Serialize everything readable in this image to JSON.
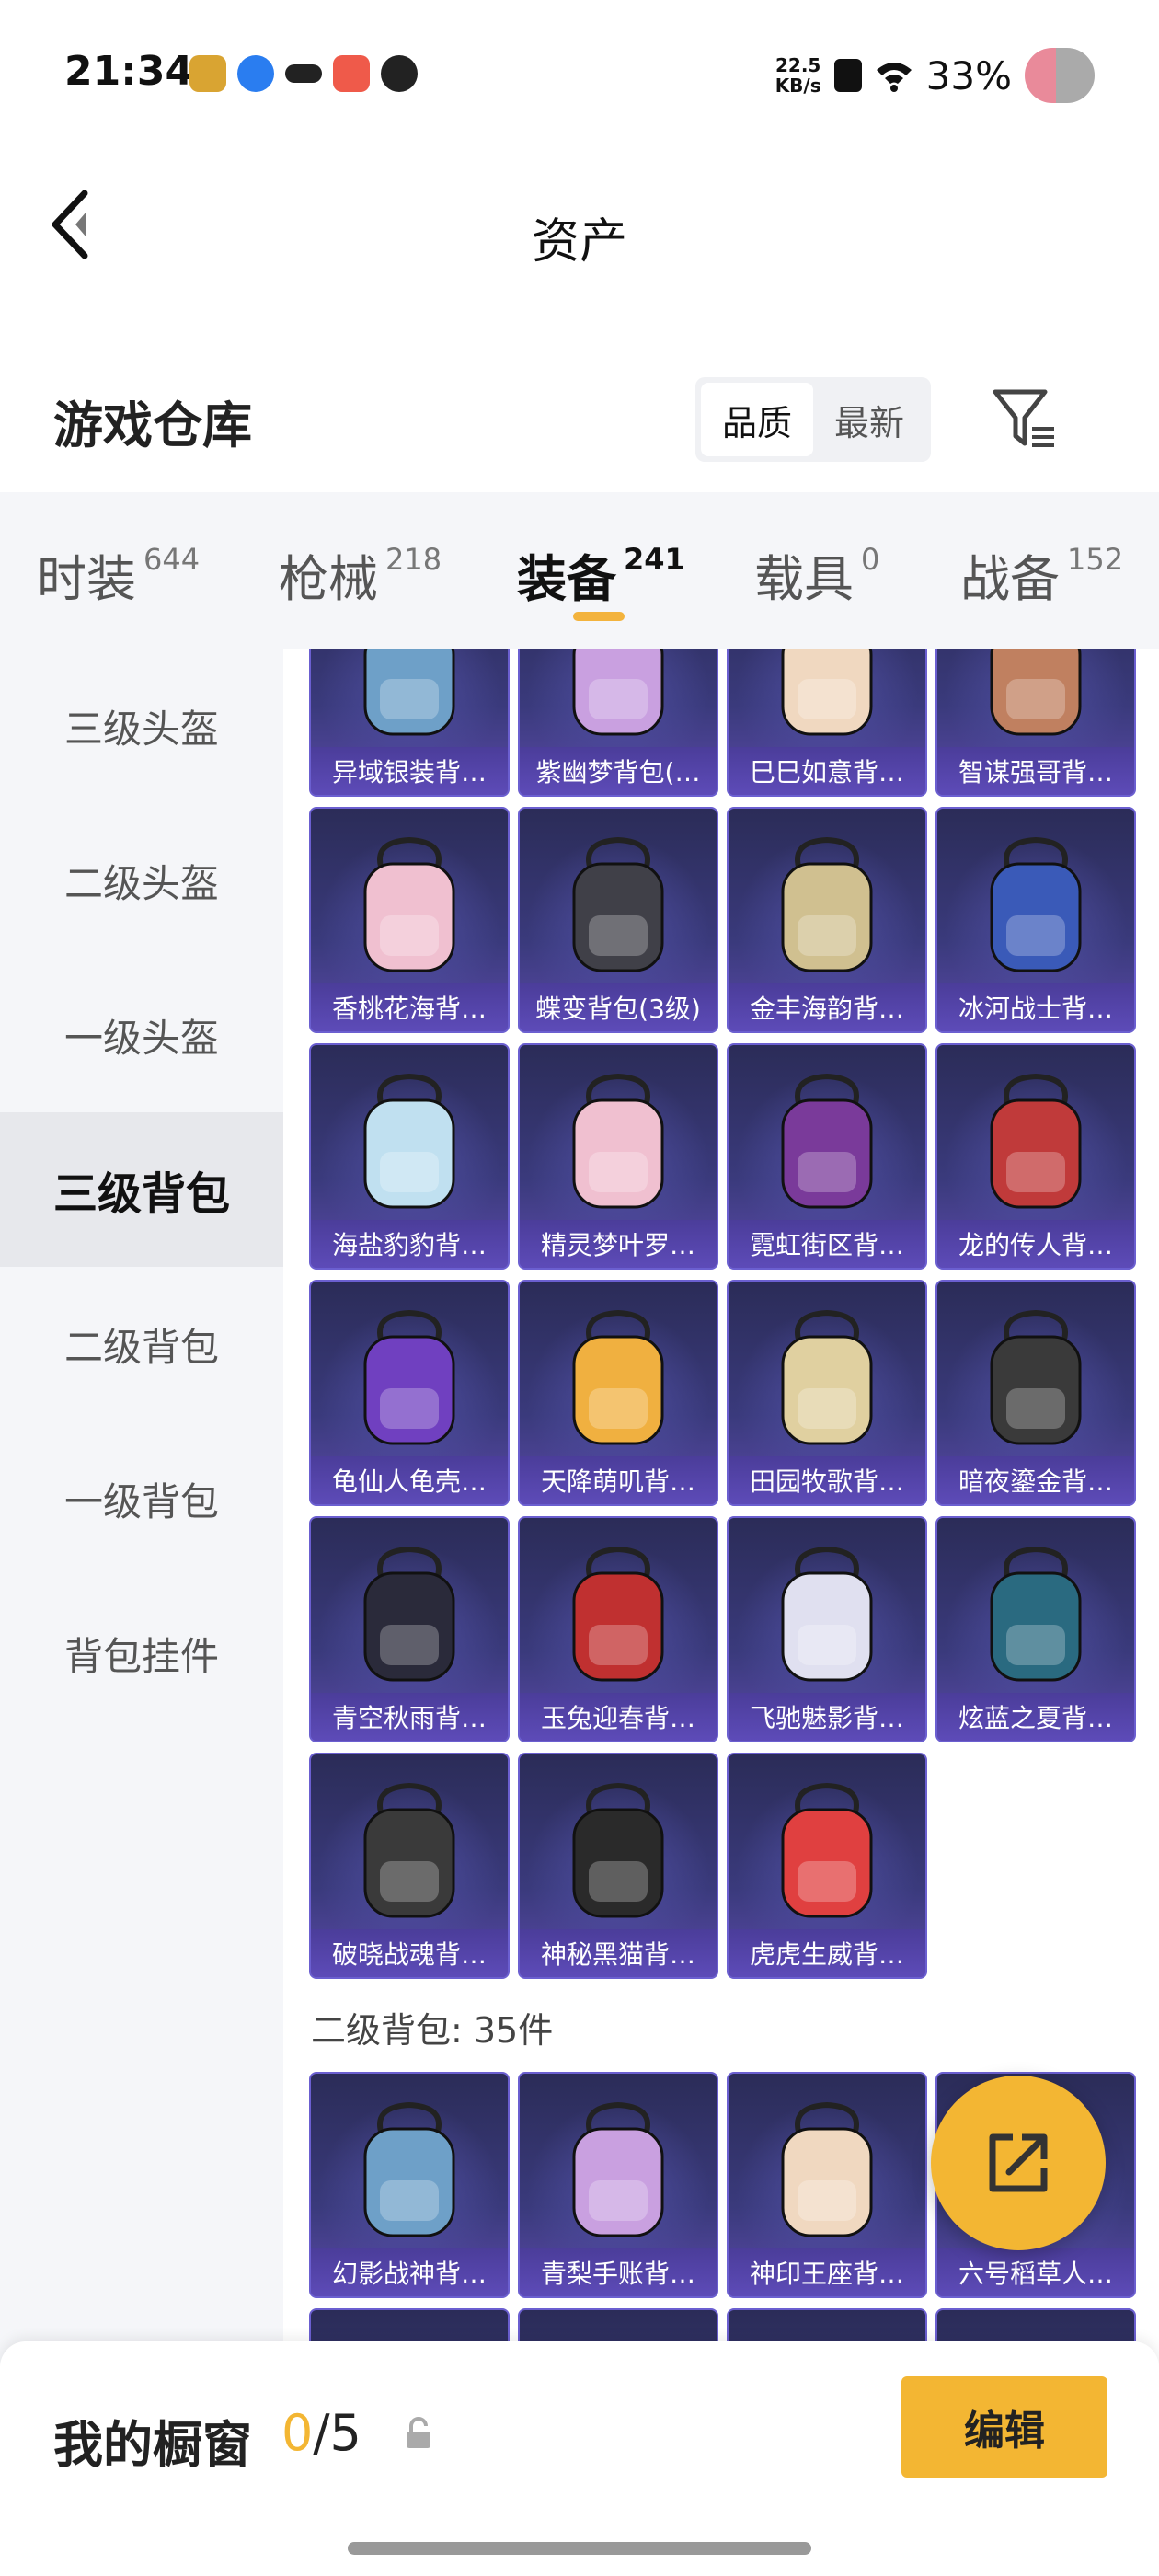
{
  "status_bar": {
    "time": "21:34",
    "net_speed_top": "22.5",
    "net_speed_bottom": "KB/s",
    "battery": "33%"
  },
  "header": {
    "title": "资产"
  },
  "warehouse": {
    "title": "游戏仓库",
    "sort_options": [
      "品质",
      "最新"
    ],
    "sort_active": "品质"
  },
  "category_tabs": [
    {
      "label": "时装",
      "count": "644"
    },
    {
      "label": "枪械",
      "count": "218"
    },
    {
      "label": "装备",
      "count": "241",
      "active": true
    },
    {
      "label": "载具",
      "count": "0"
    },
    {
      "label": "战备",
      "count": "152"
    }
  ],
  "sidebar": [
    {
      "label": "三级头盔"
    },
    {
      "label": "二级头盔"
    },
    {
      "label": "一级头盔"
    },
    {
      "label": "三级背包",
      "active": true
    },
    {
      "label": "二级背包"
    },
    {
      "label": "一级背包"
    },
    {
      "label": "背包挂件"
    }
  ],
  "grid": {
    "rows": [
      [
        "异域银装背…",
        "紫幽梦背包(…",
        "巳巳如意背…",
        "智谋强哥背…"
      ],
      [
        "香桃花海背…",
        "蝶变背包(3级)",
        "金丰海韵背…",
        "冰河战士背…"
      ],
      [
        "海盐豹豹背…",
        "精灵梦叶罗…",
        "霓虹街区背…",
        "龙的传人背…"
      ],
      [
        "龟仙人龟壳…",
        "天降萌叽背…",
        "田园牧歌背…",
        "暗夜鎏金背…"
      ],
      [
        "青空秋雨背…",
        "玉兔迎春背…",
        "飞驰魅影背…",
        "炫蓝之夏背…"
      ],
      [
        "破晓战魂背…",
        "神秘黑猫背…",
        "虎虎生威背…"
      ]
    ],
    "section2_label": "二级背包: 35件",
    "section2_rows": [
      [
        "幻影战神背…",
        "青梨手账背…",
        "神印王座背…",
        "六号稻草人…"
      ]
    ]
  },
  "bottom_bar": {
    "title": "我的橱窗",
    "count_current": "0",
    "count_total": "/5",
    "edit_label": "编辑"
  },
  "colors": {
    "accent": "#f3b633",
    "card_bg": "#2b2c58",
    "card_label_bg": "#5d4bb8"
  }
}
